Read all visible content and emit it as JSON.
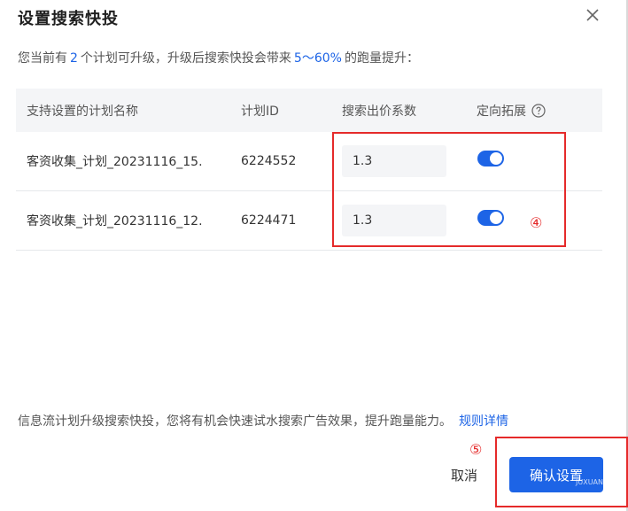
{
  "dialog": {
    "title": "设置搜索快投",
    "summary": {
      "part1": "您当前有",
      "plan_count": "2",
      "part2": "个计划可升级，升级后搜索快投会带来",
      "boost_range": "5～60%",
      "part3": "的跑量提升："
    },
    "table": {
      "headers": [
        "支持设置的计划名称",
        "计划ID",
        "搜索出价系数",
        "定向拓展"
      ],
      "rows": [
        {
          "name": "客资收集_计划_20231116_15.",
          "id": "6224552",
          "coefficient": "1.3",
          "targeting_expansion": true
        },
        {
          "name": "客资收集_计划_20231116_12.",
          "id": "6224471",
          "coefficient": "1.3",
          "targeting_expansion": true
        }
      ]
    },
    "annotations": {
      "mark_4": "④",
      "mark_5": "⑤"
    },
    "footer_note": "信息流计划升级搜索快投，您将有机会快速试水搜索广告效果，提升跑量能力。",
    "rules_link": "规则详情",
    "cancel_label": "取消",
    "confirm_label": "确认设置",
    "watermark": "JUXUAN.R"
  },
  "colors": {
    "accent": "#1d64e6",
    "annotation_red": "#e52a2a",
    "header_bg": "#f4f5f7"
  },
  "icons": {
    "close": "close-icon",
    "help": "question-circle-icon"
  }
}
